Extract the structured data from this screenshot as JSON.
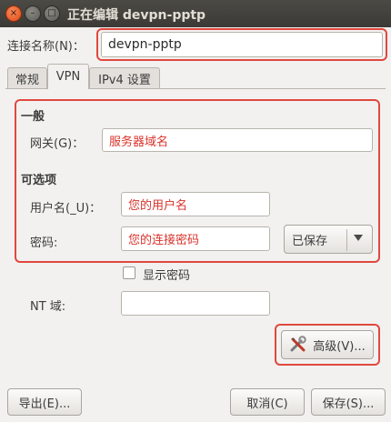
{
  "window": {
    "title": "正在编辑 devpn-pptp",
    "controls": [
      "×",
      "–",
      "□"
    ]
  },
  "connection_name": {
    "label": "连接名称(N)：",
    "value": "devpn-pptp"
  },
  "tabs": [
    {
      "label": "常规"
    },
    {
      "label": "VPN"
    },
    {
      "label": "IPv4 设置"
    }
  ],
  "general": {
    "heading": "一般",
    "gateway_label": "网关(G)：",
    "gateway_placeholder": "服务器域名"
  },
  "optional": {
    "heading": "可选项",
    "username_label": "用户名(_U)：",
    "username_placeholder": "您的用户名",
    "password_label": "密码:",
    "password_placeholder": "您的连接密码",
    "password_storage": "已保存",
    "show_password_label": "显示密码",
    "nt_domain_label": "NT 域:",
    "nt_domain_value": ""
  },
  "buttons": {
    "advanced": "高级(V)...",
    "export": "导出(E)...",
    "cancel": "取消(C)",
    "save": "保存(S)..."
  },
  "colors": {
    "highlight": "#e0483e",
    "placeholder_text": "#d9332b",
    "titlebar": "#3c3b37"
  }
}
